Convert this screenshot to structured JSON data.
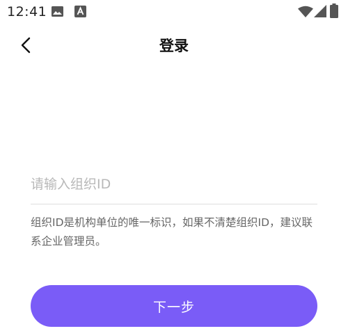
{
  "status_bar": {
    "time": "12:41",
    "icons": [
      "image-notification-icon",
      "text-a-notification-icon",
      "wifi-icon",
      "cellular-signal-icon",
      "battery-icon"
    ]
  },
  "header": {
    "title": "登录",
    "back_icon": "chevron-left-icon"
  },
  "form": {
    "org_id_value": "",
    "org_id_placeholder": "请输入组织ID",
    "hint": "组织ID是机构单位的唯一标识，如果不清楚组织ID，建议联系企业管理员。"
  },
  "actions": {
    "next_label": "下一步"
  },
  "colors": {
    "accent": "#7a5cf7",
    "placeholder": "#b8b8b8",
    "hint": "#666666",
    "divider": "#dddddd"
  }
}
